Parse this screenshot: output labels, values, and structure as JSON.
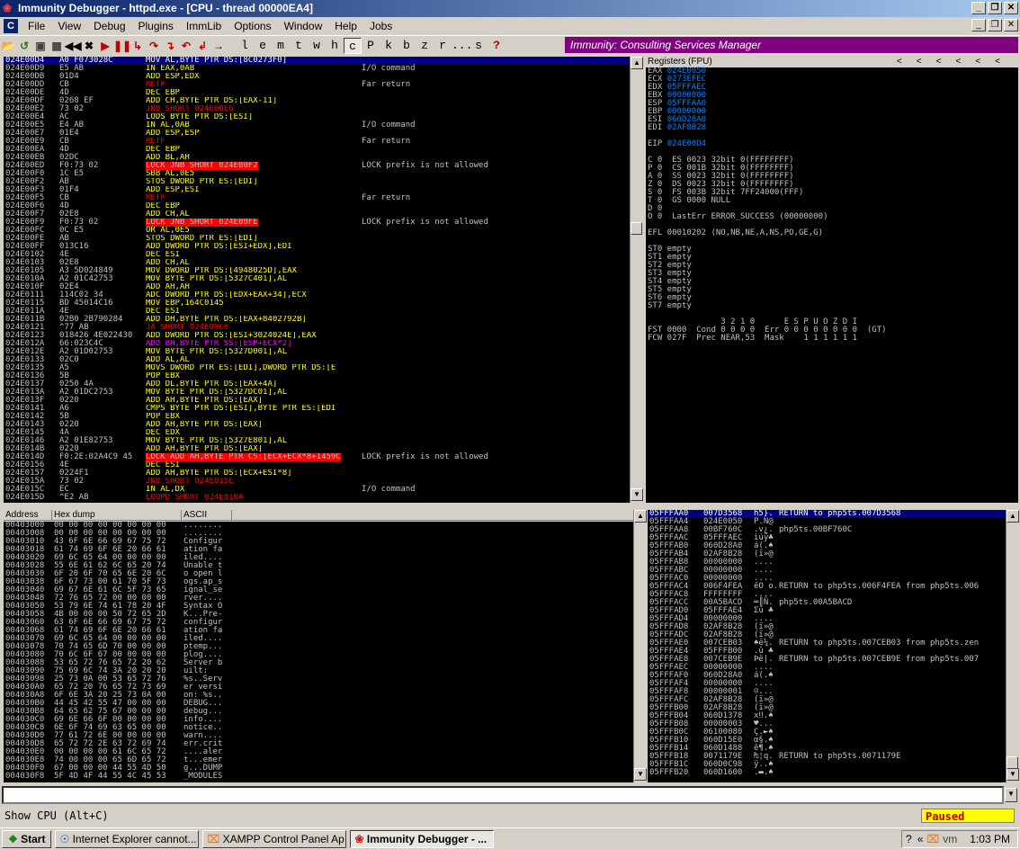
{
  "window": {
    "title": "Immunity Debugger - httpd.exe - [CPU - thread 00000EA4]",
    "icons": {
      "app": "bug-icon",
      "minimize": "minimize-icon",
      "maximize": "restore-icon",
      "close": "close-icon"
    }
  },
  "menu": [
    "File",
    "View",
    "Debug",
    "Plugins",
    "ImmLib",
    "Options",
    "Window",
    "Help",
    "Jobs"
  ],
  "toolbar": {
    "icon_buttons": [
      "open-icon",
      "restart-icon",
      "close-icon",
      "stop-icon",
      "rewind-icon",
      "close-program-icon",
      "run-icon",
      "pause-icon",
      "step-into-icon",
      "step-over-icon",
      "trace-into-icon",
      "trace-over-icon",
      "execute-till-return-icon",
      "go-to-icon"
    ],
    "letter_buttons": [
      "l",
      "e",
      "m",
      "t",
      "w",
      "h",
      "c",
      "P",
      "k",
      "b",
      "z",
      "r",
      "...",
      "s",
      "?"
    ],
    "banner": "Immunity: Consulting Services Manager"
  },
  "disasm": {
    "rows": [
      {
        "a": "024E00D4",
        "h": "A0 F073028C",
        "i": "MOV AL,BYTE PTR DS:[8C0273F0]",
        "c": "",
        "sel": true
      },
      {
        "a": "024E00D9",
        "h": "E5 AB",
        "i": "IN EAX,0AB",
        "c": "I/O command"
      },
      {
        "a": "024E00DB",
        "h": "01D4",
        "i": "ADD ESP,EDX",
        "c": ""
      },
      {
        "a": "024E00DD",
        "h": "CB",
        "i": "RETF",
        "c": "Far return",
        "red": true
      },
      {
        "a": "024E00DE",
        "h": "4D",
        "i": "DEC EBP",
        "c": ""
      },
      {
        "a": "024E00DF",
        "h": "0268 EF",
        "i": "ADD CH,BYTE PTR DS:[EAX-11]",
        "c": ""
      },
      {
        "a": "024E00E2",
        "h": "73 02",
        "i": "JNB SHORT 024E00E6",
        "c": "",
        "red": true
      },
      {
        "a": "024E00E4",
        "h": "AC",
        "i": "LODS BYTE PTR DS:[ESI]",
        "c": ""
      },
      {
        "a": "024E00E5",
        "h": "E4 AB",
        "i": "IN AL,0AB",
        "c": "I/O command"
      },
      {
        "a": "024E00E7",
        "h": "01E4",
        "i": "ADD ESP,ESP",
        "c": ""
      },
      {
        "a": "024E00E9",
        "h": "CB",
        "i": "RETF",
        "c": "Far return",
        "red": true
      },
      {
        "a": "024E00EA",
        "h": "4D",
        "i": "DEC EBP",
        "c": ""
      },
      {
        "a": "024E00EB",
        "h": "02DC",
        "i": "ADD BL,AH",
        "c": ""
      },
      {
        "a": "024E00ED",
        "h": "F0:73 02",
        "i": "LOCK JNB SHORT 024E00F2",
        "c": "LOCK prefix is not allowed",
        "bad": true
      },
      {
        "a": "024E00F0",
        "h": "1C E5",
        "i": "SBB AL,0E5",
        "c": ""
      },
      {
        "a": "024E00F2",
        "h": "AB",
        "i": "STOS DWORD PTR ES:[EDI]",
        "c": ""
      },
      {
        "a": "024E00F3",
        "h": "01F4",
        "i": "ADD ESP,ESI",
        "c": ""
      },
      {
        "a": "024E00F5",
        "h": "CB",
        "i": "RETF",
        "c": "Far return",
        "red": true
      },
      {
        "a": "024E00F6",
        "h": "4D",
        "i": "DEC EBP",
        "c": ""
      },
      {
        "a": "024E00F7",
        "h": "02E8",
        "i": "ADD CH,AL",
        "c": ""
      },
      {
        "a": "024E00F9",
        "h": "F0:73 02",
        "i": "LOCK JNB SHORT 024E00FE",
        "c": "LOCK prefix is not allowed",
        "bad": true
      },
      {
        "a": "024E00FC",
        "h": "0C E5",
        "i": "OR AL,0E5",
        "c": ""
      },
      {
        "a": "024E00FE",
        "h": "AB",
        "i": "STOS DWORD PTR ES:[EDI]",
        "c": ""
      },
      {
        "a": "024E00FF",
        "h": "013C16",
        "i": "ADD DWORD PTR DS:[ESI+EDX],EDI",
        "c": ""
      },
      {
        "a": "024E0102",
        "h": "4E",
        "i": "DEC ESI",
        "c": ""
      },
      {
        "a": "024E0103",
        "h": "02E8",
        "i": "ADD CH,AL",
        "c": ""
      },
      {
        "a": "024E0105",
        "h": "A3 5D024849",
        "i": "MOV DWORD PTR DS:[4948025D],EAX",
        "c": ""
      },
      {
        "a": "024E010A",
        "h": "A2 01C42753",
        "i": "MOV BYTE PTR DS:[5327C401],AL",
        "c": ""
      },
      {
        "a": "024E010F",
        "h": "02E4",
        "i": "ADD AH,AH",
        "c": ""
      },
      {
        "a": "024E0111",
        "h": "114C02 34",
        "i": "ADC DWORD PTR DS:[EDX+EAX+34],ECX",
        "c": ""
      },
      {
        "a": "024E0115",
        "h": "BD 45014C16",
        "i": "MOV EBP,164C0145",
        "c": ""
      },
      {
        "a": "024E011A",
        "h": "4E",
        "i": "DEC ESI",
        "c": ""
      },
      {
        "a": "024E011B",
        "h": "02B0 2B790284",
        "i": "ADD DH,BYTE PTR DS:[EAX+8402792B]",
        "c": ""
      },
      {
        "a": "024E0121",
        "h": "^77 AB",
        "i": "JA SHORT 024E00CE",
        "c": "",
        "red": true
      },
      {
        "a": "024E0123",
        "h": "018426 4E022430",
        "i": "ADD DWORD PTR DS:[ESI+3024024E],EAX",
        "c": ""
      },
      {
        "a": "024E012A",
        "h": "66:023C4C",
        "i": "ADD BH,BYTE PTR SS:[ESP+ECX*2]",
        "c": "",
        "mag": true
      },
      {
        "a": "024E012E",
        "h": "A2 01D02753",
        "i": "MOV BYTE PTR DS:[5327D001],AL",
        "c": ""
      },
      {
        "a": "024E0133",
        "h": "02C0",
        "i": "ADD AL,AL",
        "c": ""
      },
      {
        "a": "024E0135",
        "h": "A5",
        "i": "MOVS DWORD PTR ES:[EDI],DWORD PTR DS:[E",
        "c": ""
      },
      {
        "a": "024E0136",
        "h": "5B",
        "i": "POP EBX",
        "c": ""
      },
      {
        "a": "024E0137",
        "h": "0250 4A",
        "i": "ADD DL,BYTE PTR DS:[EAX+4A]",
        "c": ""
      },
      {
        "a": "024E013A",
        "h": "A2 01DC2753",
        "i": "MOV BYTE PTR DS:[5327DC01],AL",
        "c": ""
      },
      {
        "a": "024E013F",
        "h": "0220",
        "i": "ADD AH,BYTE PTR DS:[EAX]",
        "c": ""
      },
      {
        "a": "024E0141",
        "h": "A6",
        "i": "CMPS BYTE PTR DS:[ESI],BYTE PTR ES:[EDI",
        "c": ""
      },
      {
        "a": "024E0142",
        "h": "5B",
        "i": "POP EBX",
        "c": ""
      },
      {
        "a": "024E0143",
        "h": "0220",
        "i": "ADD AH,BYTE PTR DS:[EAX]",
        "c": ""
      },
      {
        "a": "024E0145",
        "h": "4A",
        "i": "DEC EDX",
        "c": ""
      },
      {
        "a": "024E0146",
        "h": "A2 01E82753",
        "i": "MOV BYTE PTR DS:[5327E801],AL",
        "c": ""
      },
      {
        "a": "024E014B",
        "h": "0220",
        "i": "ADD AH,BYTE PTR DS:[EAX]",
        "c": ""
      },
      {
        "a": "024E014D",
        "h": "F0:2E:02A4C9 45",
        "i": "LOCK ADD AH,BYTE PTR CS:[ECX+ECX*8+1459C",
        "c": "LOCK prefix is not allowed",
        "bad": true
      },
      {
        "a": "024E0156",
        "h": "4E",
        "i": "DEC ESI",
        "c": ""
      },
      {
        "a": "024E0157",
        "h": "0224F1",
        "i": "ADD AH,BYTE PTR DS:[ECX+ESI*8]",
        "c": ""
      },
      {
        "a": "024E015A",
        "h": "73 02",
        "i": "JNB SHORT 024E015E",
        "c": "",
        "red": true
      },
      {
        "a": "024E015C",
        "h": "EC",
        "i": "IN AL,DX",
        "c": "I/O command"
      },
      {
        "a": "024E015D",
        "h": "^E2 AB",
        "i": "LOOPD SHORT 024E010A",
        "c": "",
        "red": true
      }
    ]
  },
  "registers": {
    "header": "Registers (FPU)",
    "gp": [
      {
        "n": "EAX",
        "v": "024E0050"
      },
      {
        "n": "ECX",
        "v": "0273EFEC"
      },
      {
        "n": "EDX",
        "v": "05FFFAEC"
      },
      {
        "n": "EBX",
        "v": "00000000"
      },
      {
        "n": "ESP",
        "v": "05FFFAA0"
      },
      {
        "n": "EBP",
        "v": "00000000"
      },
      {
        "n": "ESI",
        "v": "060D28A0"
      },
      {
        "n": "EDI",
        "v": "02AF8B28"
      }
    ],
    "eip": {
      "n": "EIP",
      "v": "024E00D4"
    },
    "flags": [
      "C 0  ES 0023 32bit 0(FFFFFFFF)",
      "P 0  CS 001B 32bit 0(FFFFFFFF)",
      "A 0  SS 0023 32bit 0(FFFFFFFF)",
      "Z 0  DS 0023 32bit 0(FFFFFFFF)",
      "S 0  FS 003B 32bit 7FF24000(FFF)",
      "T 0  GS 0000 NULL",
      "D 0",
      "O 0  LastErr ERROR_SUCCESS (00000000)"
    ],
    "efl": "EFL 00010202 (NO,NB,NE,A,NS,PO,GE,G)",
    "fpu": [
      "ST0 empty",
      "ST1 empty",
      "ST2 empty",
      "ST3 empty",
      "ST4 empty",
      "ST5 empty",
      "ST6 empty",
      "ST7 empty"
    ],
    "fpu_status": [
      "               3 2 1 0      E S P U O Z D I",
      "FST 0000  Cond 0 0 0 0  Err 0 0 0 0 0 0 0 0  (GT)",
      "FCW 027F  Prec NEAR,53  Mask    1 1 1 1 1 1"
    ]
  },
  "dump": {
    "headers": [
      "Address",
      "Hex dump",
      "ASCII"
    ],
    "rows": [
      [
        "00403000",
        "00 00 00 00 00 00 00 00",
        "........"
      ],
      [
        "00403008",
        "00 00 00 00 00 00 00 00",
        "........"
      ],
      [
        "00403010",
        "43 6F 6E 66 69 67 75 72",
        "Configur"
      ],
      [
        "00403018",
        "61 74 69 6F 6E 20 66 61",
        "ation fa"
      ],
      [
        "00403020",
        "69 6C 65 64 00 00 00 00",
        "iled...."
      ],
      [
        "00403028",
        "55 6E 61 62 6C 65 20 74",
        "Unable t"
      ],
      [
        "00403030",
        "6F 20 6F 70 65 6E 20 6C",
        "o open l"
      ],
      [
        "00403038",
        "6F 67 73 00 61 70 5F 73",
        "ogs.ap_s"
      ],
      [
        "00403040",
        "69 67 6E 61 6C 5F 73 65",
        "ignal_se"
      ],
      [
        "00403048",
        "72 76 65 72 00 00 00 00",
        "rver...."
      ],
      [
        "00403050",
        "53 79 6E 74 61 78 20 4F",
        "Syntax O"
      ],
      [
        "00403058",
        "4B 00 00 00 50 72 65 2D",
        "K...Pre-"
      ],
      [
        "00403060",
        "63 6F 6E 66 69 67 75 72",
        "configur"
      ],
      [
        "00403068",
        "61 74 69 6F 6E 20 66 61",
        "ation fa"
      ],
      [
        "00403070",
        "69 6C 65 64 00 00 00 00",
        "iled...."
      ],
      [
        "00403078",
        "70 74 65 6D 70 00 00 00",
        "ptemp..."
      ],
      [
        "00403080",
        "70 6C 6F 67 00 00 00 00",
        "plog...."
      ],
      [
        "00403088",
        "53 65 72 76 65 72 20 62",
        "Server b"
      ],
      [
        "00403090",
        "75 69 6C 74 3A 20 20 20",
        "uilt:   "
      ],
      [
        "00403098",
        "25 73 0A 00 53 65 72 76",
        "%s..Serv"
      ],
      [
        "004030A0",
        "65 72 20 76 65 72 73 69",
        "er versi"
      ],
      [
        "004030A8",
        "6F 6E 3A 20 25 73 0A 00",
        "on: %s.."
      ],
      [
        "004030B0",
        "44 45 42 55 47 00 00 00",
        "DEBUG..."
      ],
      [
        "004030B8",
        "64 65 62 75 67 00 00 00",
        "debug..."
      ],
      [
        "004030C0",
        "69 6E 66 6F 00 00 00 00",
        "info...."
      ],
      [
        "004030C8",
        "6E 6F 74 69 63 65 00 00",
        "notice.."
      ],
      [
        "004030D0",
        "77 61 72 6E 00 00 00 00",
        "warn...."
      ],
      [
        "004030D8",
        "65 72 72 2E 63 72 69 74",
        "err.crit"
      ],
      [
        "004030E0",
        "00 00 00 00 61 6C 65 72",
        "....aler"
      ],
      [
        "004030E8",
        "74 00 00 00 65 6D 65 72",
        "t...emer"
      ],
      [
        "004030F0",
        "67 00 00 00 44 55 4D 50",
        "g...DUMP"
      ],
      [
        "004030F8",
        "5F 4D 4F 44 55 4C 45 53",
        "_MODULES"
      ]
    ]
  },
  "stack": {
    "rows": [
      {
        "a": "05FFFAA0",
        "v": "007D3568",
        "s": "h5}.",
        "c": "RETURN to php5ts.007D3568",
        "sel": true
      },
      {
        "a": "05FFFAA4",
        "v": "024E0050",
        "s": "P.N@",
        "c": ""
      },
      {
        "a": "05FFFAA8",
        "v": "00BF760C",
        "s": ".v¿.",
        "c": "php5ts.00BF760C"
      },
      {
        "a": "05FFFAAC",
        "v": "05FFFAEC",
        "s": "ìúÿ♣",
        "c": ""
      },
      {
        "a": "05FFFAB0",
        "v": "060D28A0",
        "s": "á(.♠",
        "c": ""
      },
      {
        "a": "05FFFAB4",
        "v": "02AF8B28",
        "s": "(ï»@",
        "c": ""
      },
      {
        "a": "05FFFAB8",
        "v": "00000000",
        "s": "....",
        "c": ""
      },
      {
        "a": "05FFFABC",
        "v": "00000000",
        "s": "....",
        "c": ""
      },
      {
        "a": "05FFFAC0",
        "v": "00000000",
        "s": "....",
        "c": ""
      },
      {
        "a": "05FFFAC4",
        "v": "006F4FEA",
        "s": "êO o.",
        "c": "RETURN to php5ts.006F4FEA from php5ts.006"
      },
      {
        "a": "05FFFAC8",
        "v": "FFFFFFFF",
        "s": "....",
        "c": ""
      },
      {
        "a": "05FFFACC",
        "v": "00A5BACD",
        "s": "═║Ñ.",
        "c": "php5ts.00A5BACD"
      },
      {
        "a": "05FFFAD0",
        "v": "05FFFAE4",
        "s": "Σú ♣",
        "c": ""
      },
      {
        "a": "05FFFAD4",
        "v": "00000000",
        "s": "....",
        "c": ""
      },
      {
        "a": "05FFFAD8",
        "v": "02AF8B28",
        "s": "(ï»@",
        "c": ""
      },
      {
        "a": "05FFFADC",
        "v": "02AF8B28",
        "s": "(ï»@",
        "c": ""
      },
      {
        "a": "05FFFAE0",
        "v": "007CEB03",
        "s": "♠ë¼.",
        "c": "RETURN to php5ts.007CEB03 from php5ts.zen"
      },
      {
        "a": "05FFFAE4",
        "v": "05FFFB00",
        "s": ".û ♣",
        "c": ""
      },
      {
        "a": "05FFFAE8",
        "v": "007CEB9E",
        "s": "Þë|.",
        "c": "RETURN to php5ts.007CEB9E from php5ts.007"
      },
      {
        "a": "05FFFAEC",
        "v": "00000000",
        "s": "....",
        "c": ""
      },
      {
        "a": "05FFFAF0",
        "v": "060D28A0",
        "s": "á(.♠",
        "c": ""
      },
      {
        "a": "05FFFAF4",
        "v": "00000000",
        "s": "....",
        "c": ""
      },
      {
        "a": "05FFFAF8",
        "v": "00000001",
        "s": "☺...",
        "c": ""
      },
      {
        "a": "05FFFAFC",
        "v": "02AF8B28",
        "s": "(ï»@",
        "c": ""
      },
      {
        "a": "05FFFB00",
        "v": "02AF8B28",
        "s": "(ï»@",
        "c": ""
      },
      {
        "a": "05FFFB04",
        "v": "060D1378",
        "s": "x‼.♠",
        "c": ""
      },
      {
        "a": "05FFFB08",
        "v": "00000003",
        "s": "♥...",
        "c": ""
      },
      {
        "a": "05FFFB0C",
        "v": "06100080",
        "s": "Ç.►♠",
        "c": ""
      },
      {
        "a": "05FFFB10",
        "v": "060D15E0",
        "s": "α§.♠",
        "c": ""
      },
      {
        "a": "05FFFB14",
        "v": "060D1488",
        "s": "ê¶.♠",
        "c": ""
      },
      {
        "a": "05FFFB18",
        "v": "0071179E",
        "s": "₧¦q.",
        "c": "RETURN to php5ts.0071179E"
      },
      {
        "a": "05FFFB1C",
        "v": "060D0C98",
        "s": "ÿ..♠",
        "c": ""
      },
      {
        "a": "05FFFB20",
        "v": "060D1600",
        "s": ".▬.♠",
        "c": ""
      }
    ]
  },
  "status": {
    "text": "Show CPU (Alt+C)",
    "state": "Paused"
  },
  "taskbar": {
    "start": "Start",
    "tasks": [
      "Internet Explorer cannot...",
      "XAMPP Control Panel Ap...",
      "Immunity Debugger - ..."
    ],
    "clock": "1:03 PM"
  }
}
